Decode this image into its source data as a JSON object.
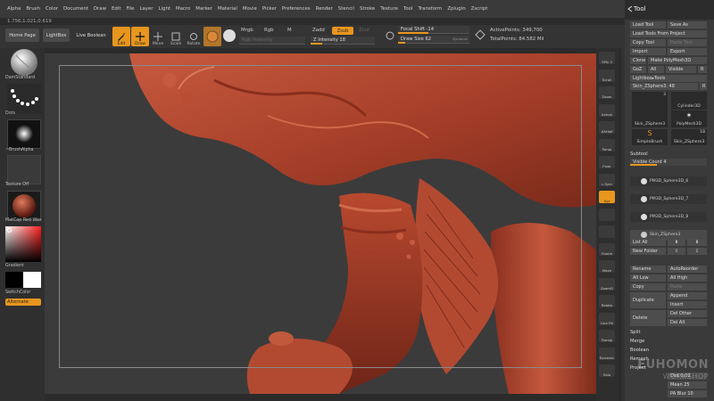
{
  "menu": [
    "Alpha",
    "Brush",
    "Color",
    "Document",
    "Draw",
    "Edit",
    "File",
    "Layer",
    "Light",
    "Macro",
    "Marker",
    "Material",
    "Movie",
    "Picker",
    "Preferences",
    "Render",
    "Stencil",
    "Stroke",
    "Texture",
    "Tool",
    "Transform",
    "Zplugin",
    "Zscript"
  ],
  "version": "1.756,1.021,0.619",
  "shelf": {
    "home": "Home Page",
    "lightbox": "LightBox",
    "live_boolean": "Live Boolean",
    "edit": "Edit",
    "draw": "Draw",
    "move": "Move",
    "scale": "Scale",
    "rotate": "Rotate",
    "mrgb": "Mrgb",
    "rgb": "Rgb",
    "m": "M",
    "rgb_intensity": "Rgb Intensity",
    "zadd": "Zadd",
    "zsub": "Zsub",
    "zcut": "Zcut",
    "z_intensity": "Z Intensity 18",
    "focal_shift": "Focal Shift -14",
    "draw_size": "Draw Size 62",
    "dynamic": "Dynamic",
    "active_points": "ActivePoints: 349,700",
    "total_points": "TotalPoints: 84.582 Mil"
  },
  "slider_levels": {
    "z_intensity": 0.18,
    "focal_shift": 0.43,
    "draw_size": 0.1
  },
  "left": {
    "brush": "DamStandard",
    "stroke": "Dots",
    "alpha": "~BrushAlpha",
    "texture": "Texture Off",
    "material": "MatCap Red Wax",
    "gradient": "Gradient",
    "switch_color": "SwitchColor",
    "alternate": "Alternate"
  },
  "right_shelf": [
    "SPix 3",
    "Scroll",
    "Zoom",
    "Actual",
    "AAHalf",
    "Persp",
    "Floor",
    "L.Sym",
    "Xyz",
    "",
    "",
    "Frame",
    "Move",
    "ZoomD",
    "Rotate",
    "Line Fill",
    "Transp",
    "Dynamic",
    "Solo"
  ],
  "tool": {
    "title": "Tool",
    "load_tool": "Load Tool",
    "save_as": "Save As",
    "load_from_project": "Load Tools From Project",
    "copy_tool": "Copy Tool",
    "paste_tool": "Paste Tool",
    "import": "Import",
    "export": "Export",
    "clone": "Clone",
    "make_polymesh": "Make PolyMesh3D",
    "goz": "GoZ",
    "all": "All",
    "visible": "Visible",
    "r": "R",
    "lightbox_tools": "Lightbox▸Tools",
    "current_tool": "Skin_ZSphere3. 48",
    "r2": "R",
    "thumbs": [
      {
        "label": "Skin_ZSphere3",
        "count": "3"
      },
      {
        "label": "Cylinder3D",
        "count": ""
      },
      {
        "label": "PolyMesh3D",
        "count": ""
      },
      {
        "label": "SimpleBrush",
        "count": ""
      },
      {
        "label": "Skin_ZSphere3",
        "count": "18"
      }
    ],
    "subtool": "Subtool",
    "visible_count": "Visible Count 4",
    "subtools": [
      "PM3D_Sphere3D_6",
      "PM3D_Sphere3D_7",
      "PM3D_Sphere3D_8",
      "Skin_ZSphere3"
    ],
    "list_all": "List All",
    "new_folder": "New Folder",
    "rename": "Rename",
    "auto_reorder": "AutoReorder",
    "all_low": "All Low",
    "all_high": "All High",
    "copy": "Copy",
    "paste": "Paste",
    "duplicate": "Duplicate",
    "append": "Append",
    "insert": "Insert",
    "delete": "Delete",
    "del_other": "Del Other",
    "del_all": "Del All",
    "split": "Split",
    "merge": "Merge",
    "boolean": "Boolean",
    "remesh": "Remesh",
    "project": "Project",
    "dist": "Dist 0.02",
    "mean": "Mean 25",
    "pa_blur": "PA Blur 10"
  },
  "watermark": {
    "line1": "EUHOMON",
    "line2": "WORKSHOP"
  },
  "colors": {
    "accent": "#e8961e",
    "clay": "#b0442e",
    "bg": "#3b3b3b"
  }
}
